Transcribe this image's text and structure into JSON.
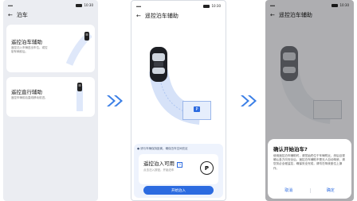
{
  "colors": {
    "accent": "#2c6be0",
    "arrow": "#3b7fe6",
    "panel": "#eef3fd"
  },
  "status": {
    "time": "10:30"
  },
  "screen1": {
    "title": "泊车",
    "cards": [
      {
        "title": "遥控泊车辅助",
        "desc": "遥控泊入车辆进出车位。或控制车辆前后。"
      },
      {
        "title": "遥控直行辅助",
        "desc": "遥控车辆前后直线移动前进。"
      }
    ]
  },
  "screen2": {
    "title": "遥控泊车辅助",
    "parking_mark": "P",
    "hint": "请与车辆保持距离，确保泊车空间充足",
    "available_title": "遥控泊入可用",
    "available_badge": "5",
    "available_sub": "点击泊入按钮，开始泊车",
    "p_button": "P",
    "start_button": "开始泊入"
  },
  "screen3": {
    "title": "遥控泊车辅助",
    "dialog": {
      "title": "确认开始泊车?",
      "body": "使用遥控泊车辅助时，请您始终位于车辆附近，然后目视确认各方向安全后，遥控泊车辅助不是无人自动驾驶，请您务必全程监控，确保安全完成，请勿在驾驶座位上操作。",
      "cancel": "取消",
      "confirm": "确定"
    }
  }
}
